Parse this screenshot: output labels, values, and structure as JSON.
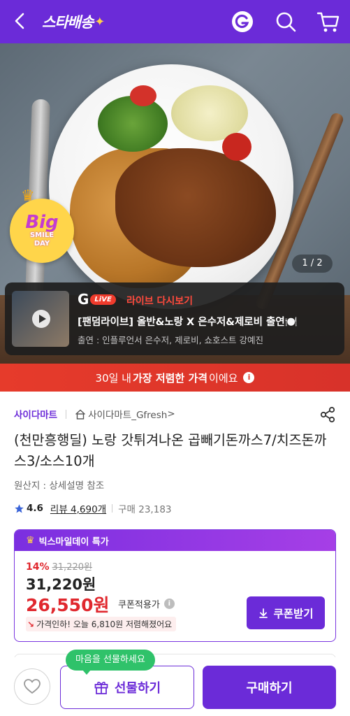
{
  "header": {
    "logo_text": "스타배송",
    "logo_star": "✦",
    "colors": {
      "brand": "#6b2bd8",
      "accent_red": "#e0282e"
    },
    "icons": [
      "back-arrow-icon",
      "g-logo-icon",
      "search-icon",
      "cart-icon"
    ]
  },
  "hero": {
    "image_counter": "1 / 2",
    "badge": {
      "big": "Big",
      "smile_day_line1": "SMILE",
      "smile_day_line2": "DAY"
    }
  },
  "live": {
    "g_text": "G",
    "live_text": "LiVE",
    "replay_label": "라이브 다시보기",
    "title": "[팬덤라이브] 올반&노랑 X 은수저&제로비 출연🍽️",
    "cast": "출연 : 인플루언서 은수저, 제로비, 쇼호스트 강예진"
  },
  "lowest_banner": {
    "prefix": "30일 내 ",
    "highlight": "가장 저렴한 가격",
    "suffix": "이에요",
    "info_glyph": "i"
  },
  "product": {
    "seller": "사이다마트",
    "store": "사이다마트_Gfresh",
    "store_chevron": ">",
    "title": "(천만흥행딜) 노랑 갓튀겨나온 곱빼기돈까스7/치즈돈까스3/소스10개",
    "origin": "원산지 : 상세설명 참조",
    "rating": "4.6",
    "reviews": "리뷰 4,690개",
    "purchases": "구매 23,183"
  },
  "price": {
    "event_label": "빅스마일데이 특가",
    "discount_pct": "14%",
    "original_price": "31,220원",
    "sale_price": "31,220원",
    "final_price": "26,550원",
    "coupon_label": "쿠폰적용가",
    "coupon_info_glyph": "i",
    "drop_text": "가격인하! 오늘 6,810원 저렴해졌어요",
    "coupon_button": "쿠폰받기"
  },
  "bottom": {
    "tooltip": "마음을 선물하세요",
    "gift_button": "선물하기",
    "buy_button": "구매하기"
  }
}
